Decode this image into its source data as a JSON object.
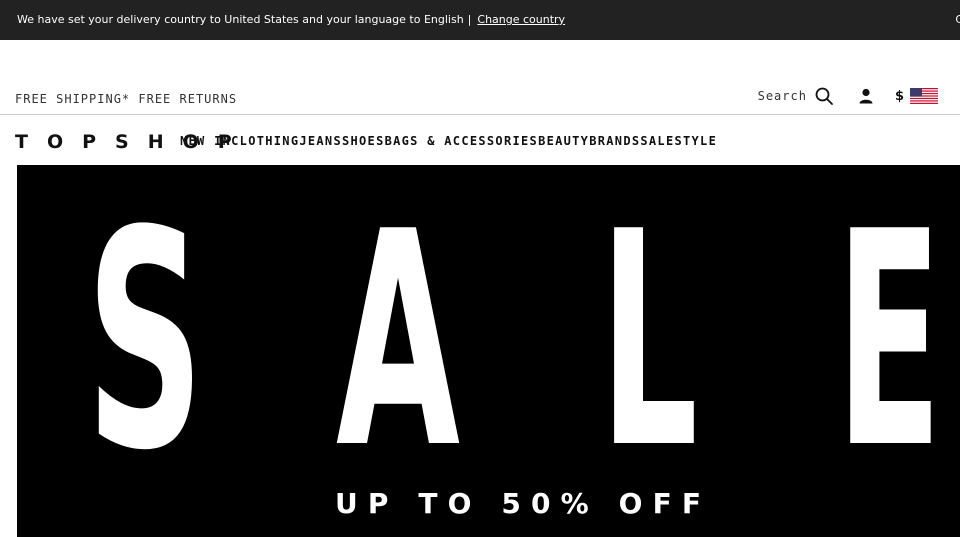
{
  "notice": {
    "message": "We have set your delivery country to United States and your language to English",
    "separator": "|",
    "link_label": "Change country",
    "trailing_glyph": "C"
  },
  "utility": {
    "free_shipping": "FREE SHIPPING* FREE RETURNS",
    "search_label": "Search",
    "currency_symbol": "$",
    "country_flag": "us-flag-icon"
  },
  "brand": {
    "logo": "TOPSHOP"
  },
  "nav": {
    "items": [
      "NEW IN",
      "CLOTHING",
      "JEANS",
      "SHOES",
      "BAGS & ACCESSORIES",
      "BEAUTY",
      "BRANDS",
      "SALE",
      "STYLE"
    ]
  },
  "hero": {
    "headline_letters": [
      "S",
      "A",
      "L",
      "E"
    ],
    "subtitle": "UP TO 50% OFF",
    "background": "#000000",
    "foreground": "#ffffff"
  },
  "colors": {
    "notice_bg": "#222222",
    "text": "#111111",
    "divider": "#cfcfcf"
  }
}
